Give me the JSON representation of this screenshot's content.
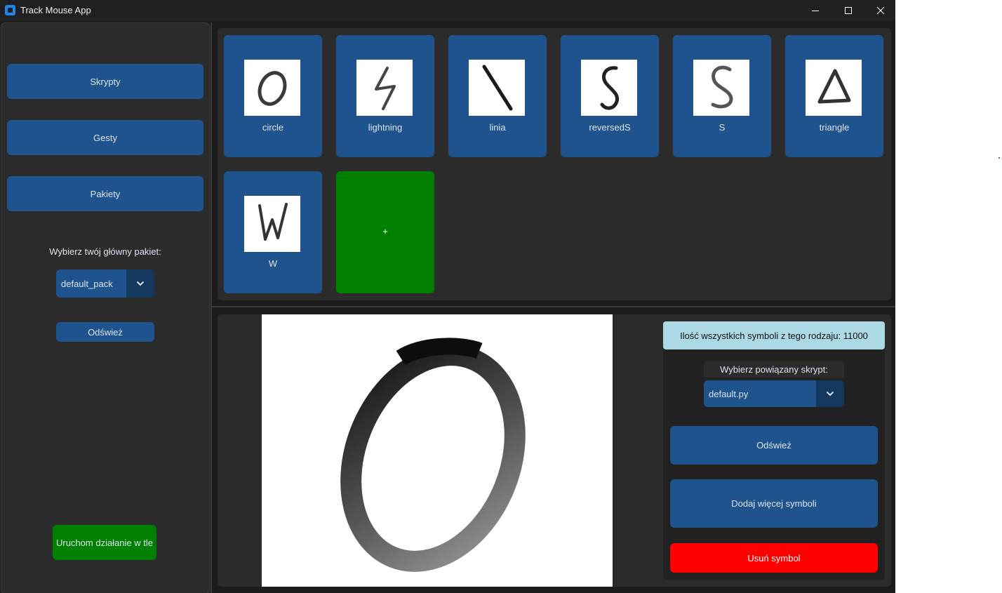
{
  "window": {
    "title": "Track Mouse App",
    "controls": [
      "minimize-icon",
      "maximize-icon",
      "close-icon"
    ]
  },
  "sidebar": {
    "buttons": [
      {
        "label": "Skrypty"
      },
      {
        "label": "Gesty"
      },
      {
        "label": "Pakiety"
      }
    ],
    "pack_prompt": "Wybierz twój główny pakiet:",
    "pack_select": {
      "value": "default_pack"
    },
    "refresh_label": "Odśwież",
    "run_background_label": "Uruchom działanie w tle"
  },
  "gestures": {
    "tiles": [
      {
        "label": "circle",
        "icon": "circle-gesture"
      },
      {
        "label": "lightning",
        "icon": "lightning-gesture"
      },
      {
        "label": "linia",
        "icon": "line-gesture"
      },
      {
        "label": "reversedS",
        "icon": "reversed-s-gesture"
      },
      {
        "label": "S",
        "icon": "s-gesture"
      },
      {
        "label": "triangle",
        "icon": "triangle-gesture"
      },
      {
        "label": "W",
        "icon": "w-gesture"
      }
    ],
    "add_label": "+"
  },
  "detail": {
    "preview_icon": "circle-gesture-large",
    "count_text": "Ilość wszystkich symboli z tego rodzaju: 11000",
    "script_prompt": "Wybierz powiązany skrypt:",
    "script_select": {
      "value": "default.py"
    },
    "refresh_label": "Odśwież",
    "add_more_label": "Dodaj więcej symboli",
    "delete_label": "Usuń symbol"
  },
  "colors": {
    "accent": "#1f538d",
    "accent_dark": "#14375e",
    "success": "#008000",
    "danger": "#ff0000",
    "info": "#add8e6",
    "panel": "#2b2b2b",
    "background": "#1c1c1c"
  }
}
